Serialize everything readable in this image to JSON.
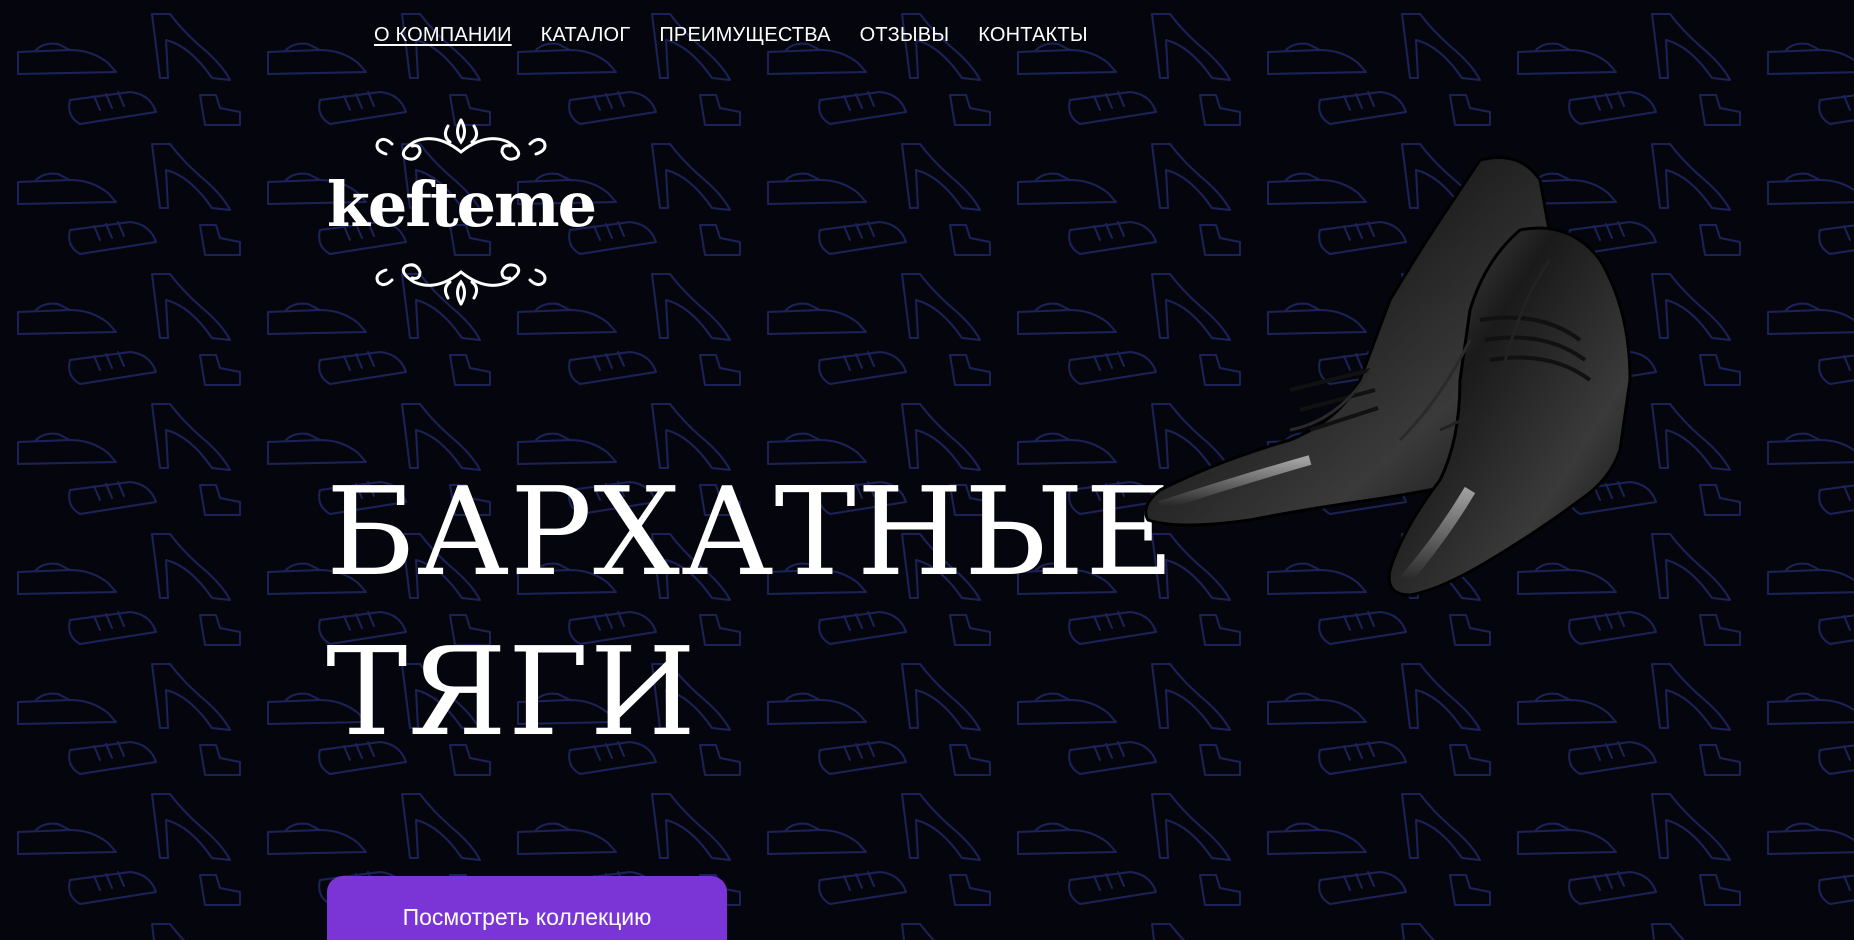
{
  "nav": {
    "items": [
      {
        "label": "О КОМПАНИИ",
        "active": true
      },
      {
        "label": "КАТАЛОГ"
      },
      {
        "label": "ПРЕИМУЩЕСТВА"
      },
      {
        "label": "ОТЗЫВЫ"
      },
      {
        "label": "КОНТАКТЫ"
      }
    ]
  },
  "logo": {
    "text": "kefteme"
  },
  "hero": {
    "title_line1": "БАРХАТНЫЕ",
    "title_line2": "ТЯГИ",
    "cta_label": "Посмотреть коллекцию"
  },
  "colors": {
    "background": "#05060d",
    "pattern_stroke": "#1c2258",
    "accent": "#7b35d6",
    "text": "#ffffff"
  },
  "icons": [
    "shoe-pattern",
    "logo-ornament",
    "leather-boots-image"
  ]
}
